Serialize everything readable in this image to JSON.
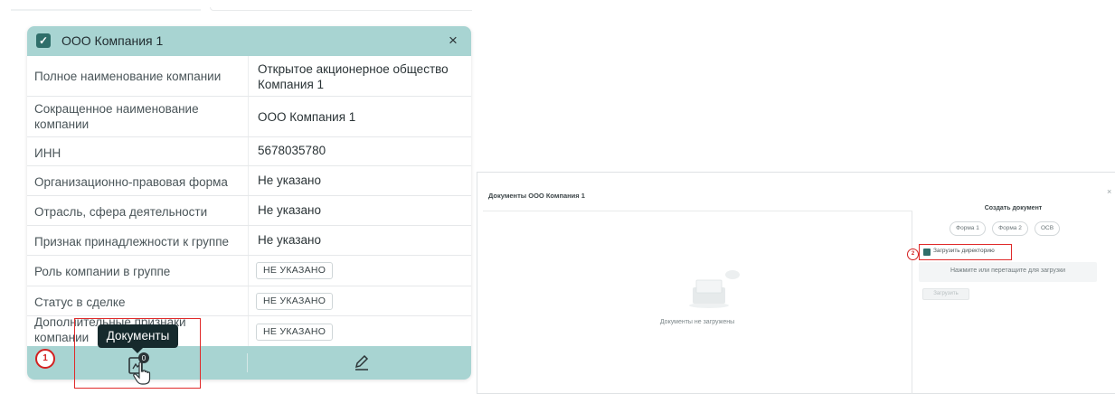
{
  "card": {
    "title": "ООО Компания 1",
    "close": "×",
    "rows": [
      {
        "label": "Полное наименование компании",
        "value": "Открытое акционерное общество Компания 1"
      },
      {
        "label": "Сокращенное наименование компании",
        "value": "ООО Компания 1"
      },
      {
        "label": "ИНН",
        "value": "5678035780"
      },
      {
        "label": "Организационно-правовая форма",
        "value": "Не указано"
      },
      {
        "label": "Отрасль, сфера деятельности",
        "value": "Не указано"
      },
      {
        "label": "Признак принадлежности к группе",
        "value": "Не указано"
      },
      {
        "label": "Роль компании в группе",
        "value": "НЕ УКАЗАНО"
      },
      {
        "label": "Статус в сделке",
        "value": "НЕ УКАЗАНО"
      },
      {
        "label": "Дополнительные признаки компании",
        "value": "НЕ УКАЗАНО"
      }
    ],
    "tooltip": "Документы",
    "doc_badge": "0"
  },
  "markers": {
    "step1": "1",
    "step2": "2"
  },
  "panel": {
    "title": "Документы ООО Компания 1",
    "close": "×",
    "empty_text": "Документы не загружены",
    "create_title": "Создать документ",
    "form_buttons": [
      "Форма 1",
      "Форма 2",
      "ОСВ"
    ],
    "dir_label": "Загрузить директорию",
    "drop_text": "Нажмите или перетащите для загрузки",
    "upload_button": "Загрузить"
  },
  "colors": {
    "accent": "#a8d4d2",
    "dark": "#2f6e6a",
    "marker": "#d32020",
    "tooltip_bg": "#162a2d"
  }
}
